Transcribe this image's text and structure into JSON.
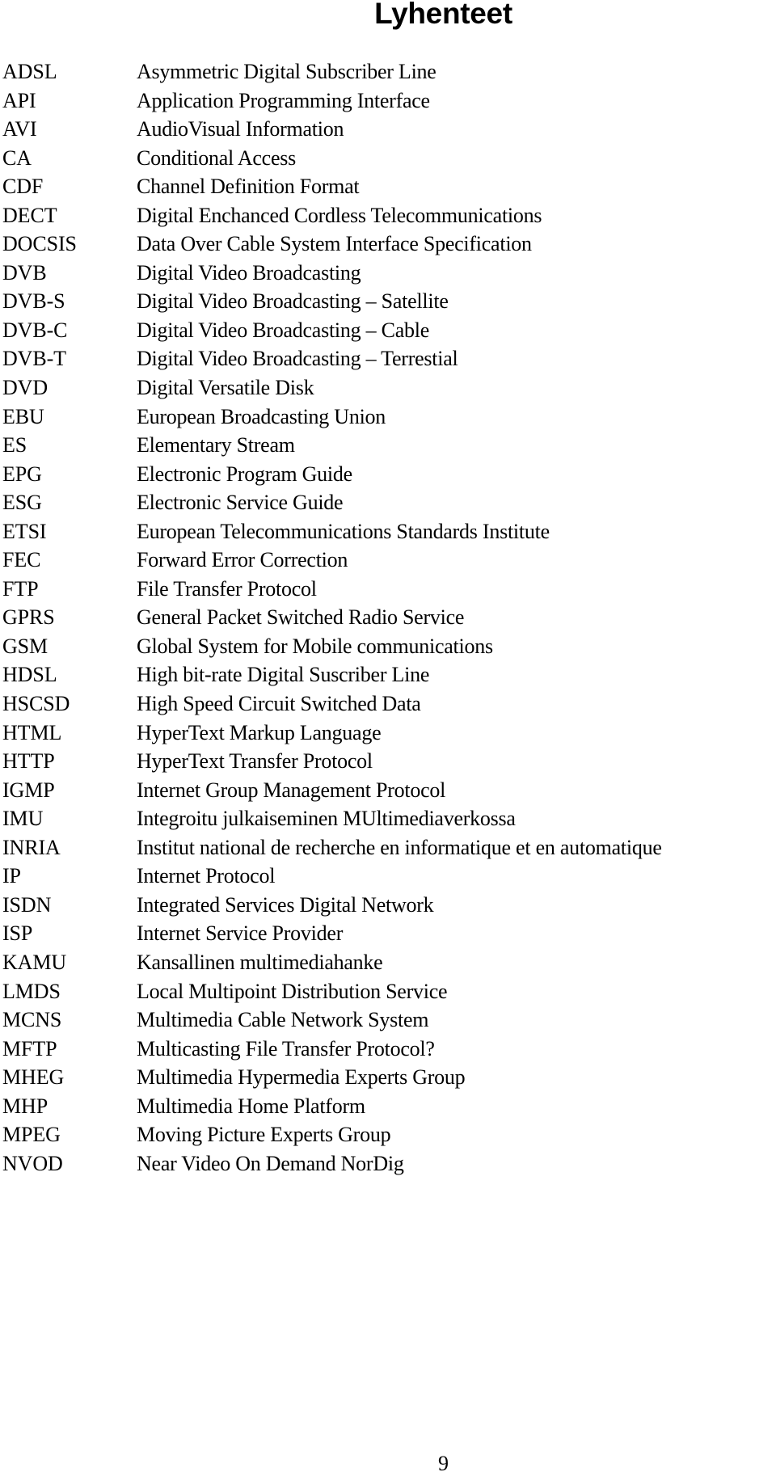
{
  "document": {
    "title": "Lyhenteet",
    "page_number": "9",
    "colors": {
      "text": "#000000",
      "background": "#ffffff"
    }
  },
  "abbreviations": [
    {
      "term": "ADSL",
      "definition": "Asymmetric Digital Subscriber Line"
    },
    {
      "term": "API",
      "definition": "Application Programming Interface"
    },
    {
      "term": "AVI",
      "definition": "AudioVisual Information"
    },
    {
      "term": "CA",
      "definition": "Conditional Access"
    },
    {
      "term": "CDF",
      "definition": "Channel Definition Format"
    },
    {
      "term": "DECT",
      "definition": "Digital Enchanced Cordless Telecommunications"
    },
    {
      "term": "DOCSIS",
      "definition": "Data Over Cable System Interface Specification"
    },
    {
      "term": "DVB",
      "definition": "Digital Video Broadcasting"
    },
    {
      "term": "DVB-S",
      "definition": "Digital Video Broadcasting – Satellite"
    },
    {
      "term": "DVB-C",
      "definition": "Digital Video Broadcasting – Cable"
    },
    {
      "term": "DVB-T",
      "definition": "Digital Video Broadcasting – Terrestial"
    },
    {
      "term": "DVD",
      "definition": "Digital Versatile Disk"
    },
    {
      "term": "EBU",
      "definition": "European Broadcasting Union"
    },
    {
      "term": "ES",
      "definition": "Elementary Stream"
    },
    {
      "term": "EPG",
      "definition": "Electronic Program Guide"
    },
    {
      "term": "ESG",
      "definition": "Electronic Service Guide"
    },
    {
      "term": "ETSI",
      "definition": "European Telecommunications Standards Institute"
    },
    {
      "term": "FEC",
      "definition": "Forward Error Correction"
    },
    {
      "term": "FTP",
      "definition": "File Transfer Protocol"
    },
    {
      "term": "GPRS",
      "definition": "General Packet Switched Radio Service"
    },
    {
      "term": "GSM",
      "definition": "Global System for Mobile communications"
    },
    {
      "term": "HDSL",
      "definition": "High bit-rate Digital Suscriber Line"
    },
    {
      "term": "HSCSD",
      "definition": "High Speed Circuit Switched Data"
    },
    {
      "term": "HTML",
      "definition": "HyperText Markup Language"
    },
    {
      "term": "HTTP",
      "definition": "HyperText Transfer Protocol"
    },
    {
      "term": "IGMP",
      "definition": "Internet Group Management Protocol"
    },
    {
      "term": "IMU",
      "definition": "Integroitu julkaiseminen MUltimediaverkossa"
    },
    {
      "term": "INRIA",
      "definition": "Institut national de recherche en informatique et en automatique"
    },
    {
      "term": "IP",
      "definition": "Internet Protocol"
    },
    {
      "term": "ISDN",
      "definition": "Integrated Services Digital Network"
    },
    {
      "term": "ISP",
      "definition": "Internet Service Provider"
    },
    {
      "term": "KAMU",
      "definition": "Kansallinen multimediahanke"
    },
    {
      "term": "LMDS",
      "definition": "Local Multipoint Distribution Service"
    },
    {
      "term": "MCNS",
      "definition": "Multimedia Cable Network System"
    },
    {
      "term": "MFTP",
      "definition": "Multicasting File Transfer Protocol?"
    },
    {
      "term": "MHEG",
      "definition": "Multimedia Hypermedia Experts Group"
    },
    {
      "term": "MHP",
      "definition": "Multimedia Home Platform"
    },
    {
      "term": "MPEG",
      "definition": "Moving Picture Experts Group"
    },
    {
      "term": "NVOD",
      "definition": "Near Video On Demand NorDig"
    }
  ]
}
